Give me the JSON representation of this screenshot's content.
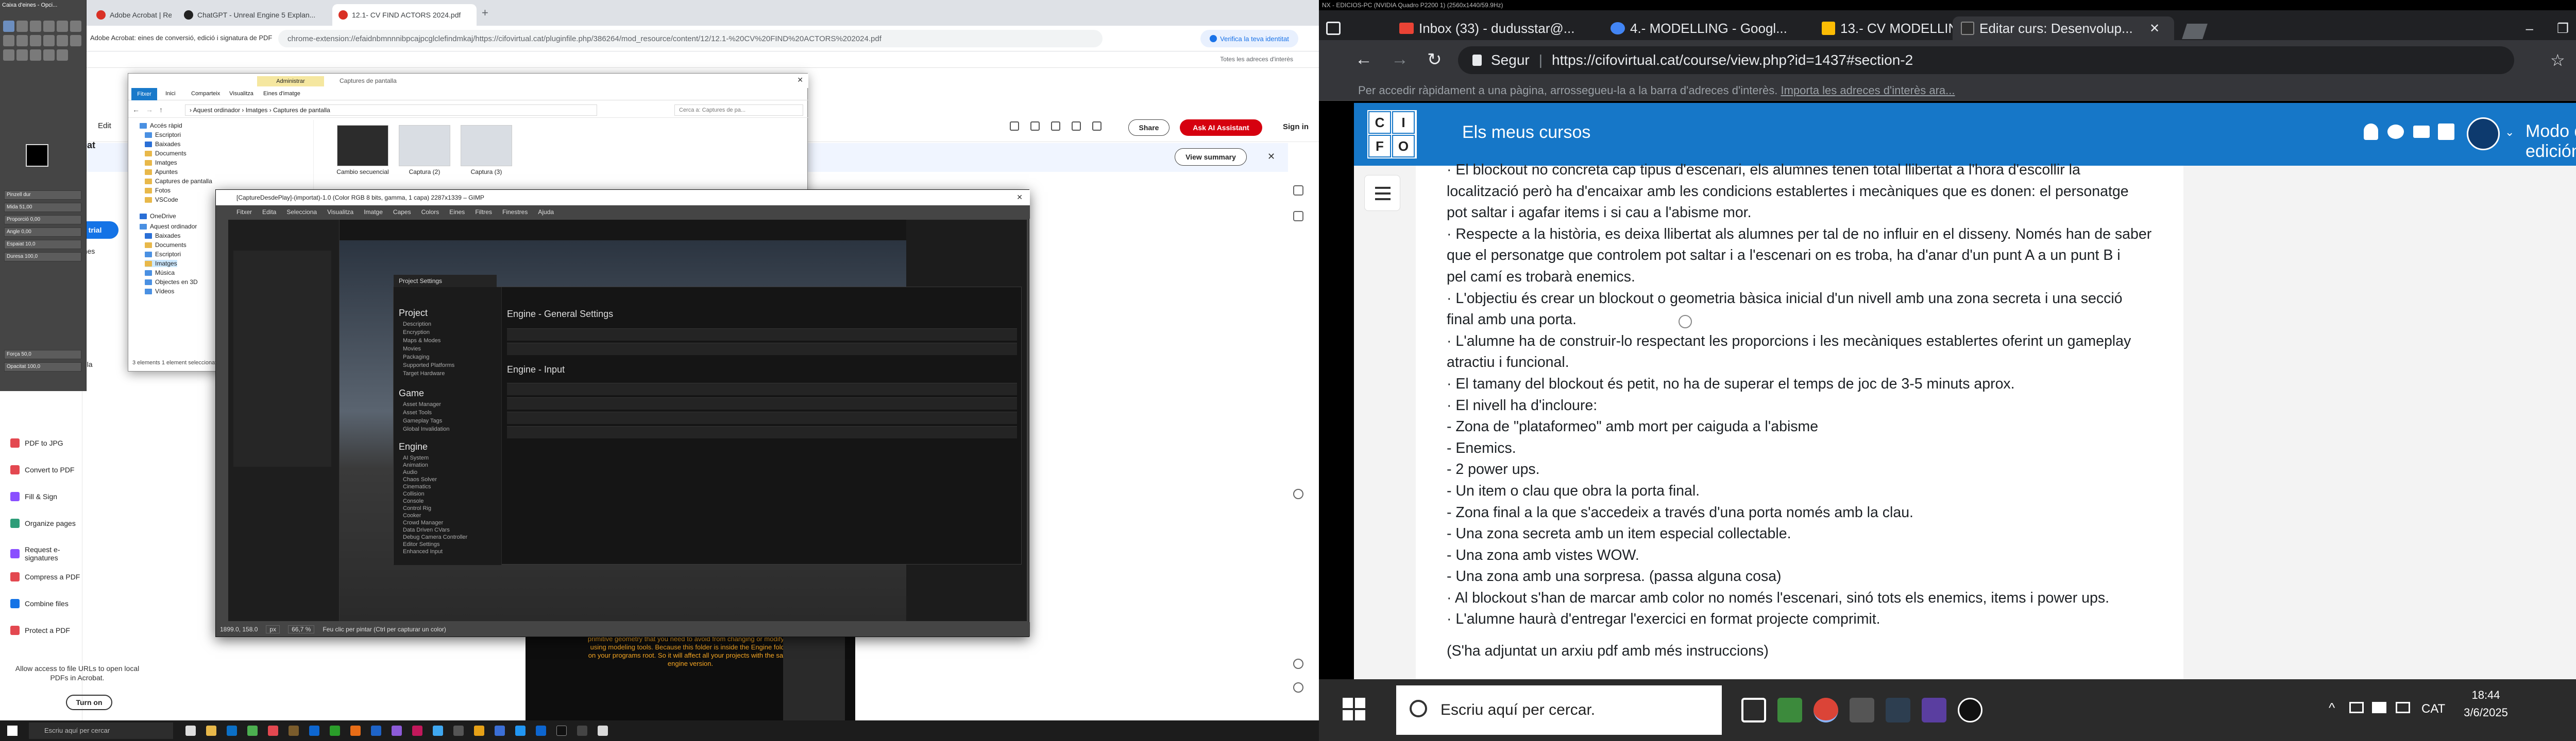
{
  "left_monitor": {
    "chrome": {
      "tabs": [
        {
          "label": "Adobe Acrobat | Resumeix fi...",
          "color": "#d93025"
        },
        {
          "label": "ChatGPT - Unreal Engine 5 Explan...",
          "color": "#222222"
        },
        {
          "label": "12.1- CV FIND ACTORS 2024.pdf",
          "color": "#d93025"
        }
      ],
      "new_tab": "+",
      "ad_label": "Adobe Acrobat: eines de conversió, edició i signatura de PDF",
      "url": "chrome-extension://efaidnbmnnnibpcajpcglclefindmkaj/https://cifovirtual.cat/pluginfile.php/386264/mod_resource/content/12/12.1-%20CV%20FIND%20ACTORS%202024.pdf",
      "verify_label": "Verifica la teva identitat",
      "bookmarks_label": "Totes les adreces d'interès"
    },
    "acrobat": {
      "edit_menu": "Edit",
      "share_label": "Share",
      "ask_label": "Ask AI Assistant",
      "signin_label": "Sign in",
      "view_summary": "View summary",
      "acrobat_partial": "crobat",
      "free_trial": "e trial",
      "tools": [
        "PDF to JPG",
        "Convert to PDF",
        "Fill & Sign",
        "Organize pages",
        "Request e-signatures",
        "Compress a PDF",
        "Combine files",
        "Protect a PDF"
      ],
      "side_frag": [
        "Ienes",
        "Icula"
      ],
      "bottom_note": "Allow access to file URLs to open local PDFs in Acrobat.",
      "turn_on": "Turn on",
      "pdf_text": "primitive geometry that you need to avoid from changing or modifying using modeling tools. Because this folder is inside the Engine folder on your programs root. So it will affect all your projects with the same engine version."
    },
    "gimp_toolbox": {
      "title": "Caixa d'eines - Opci...",
      "props": [
        "Pinzell dur",
        "Mida 51,00",
        "Proporció 0,00",
        "Angle 0,00",
        "Espaiat 10,0",
        "Duresa 100,0",
        "Força 50,0",
        "Opacitat 100,0"
      ]
    },
    "explorer": {
      "title": "Captures de pantalla",
      "manage_tab": "Administrar",
      "ribbon": [
        "Fitxer",
        "Inici",
        "Comparteix",
        "Visualitza",
        "Eines d'imatge"
      ],
      "path": "› Aquest ordinador › Imatges › Captures de pantalla",
      "search_placeholder": "Cerca a: Captures de pa...",
      "nav": [
        "Accés ràpid",
        "Escriptori",
        "Baixades",
        "Documents",
        "Imatges",
        "Apuntes",
        "Captures de pantalla",
        "Fotos",
        "VSCode",
        "OneDrive",
        "Aquest ordinador",
        "Baixades",
        "Documents",
        "Escriptori",
        "Imatges",
        "Música",
        "Objectes en 3D",
        "Vídeos"
      ],
      "files": [
        "Cambio secuencial",
        "Captura (2)",
        "Captura (3)"
      ],
      "status": "3 elements   1 element seleccionat"
    },
    "gimp_window": {
      "title": "[CaptureDesdePlay]-(importat)-1.0 (Color RGB 8 bits, gamma, 1 capa) 2287x1339 – GIMP",
      "menu": [
        "Fitxer",
        "Edita",
        "Selecciona",
        "Visualitza",
        "Imatge",
        "Capes",
        "Colors",
        "Eines",
        "Filtres",
        "Finestres",
        "Ajuda"
      ],
      "status_coords": "1899.0, 158.0",
      "status_unit": "px",
      "status_zoom": "66,7 %",
      "status_hint": "Feu clic per pintar (Ctrl per capturar un color)",
      "ue_project_settings": "Project Settings",
      "ue_side": [
        {
          "h": "Project",
          "items": [
            "Description",
            "Encryption",
            "Maps & Modes",
            "Movies",
            "Packaging",
            "Supported Platforms",
            "Target Hardware"
          ]
        },
        {
          "h": "Game",
          "items": [
            "Asset Manager",
            "Asset Tools",
            "Gameplay Tags",
            "Global Invalidation"
          ]
        },
        {
          "h": "Engine",
          "items": [
            "AI System",
            "Animation",
            "Audio",
            "Chaos Solver",
            "Cinematics",
            "Collision",
            "Console",
            "Control Rig",
            "Cooker",
            "Crowd Manager",
            "Data Driven CVars",
            "Debug Camera Controller",
            "Editor Settings",
            "Enhanced Input"
          ]
        }
      ],
      "ue_sections": [
        "Engine - General Settings",
        "Engine - Input"
      ]
    },
    "taskbar_search": "Escriu aquí per cercar"
  },
  "right_monitor": {
    "window_title": "NX - EDICIOS-PC (NVIDIA Quadro P2200 1) (2560x1440/59.9Hz)",
    "tabs": [
      {
        "label": "Inbox (33) - dudusstar@...",
        "color": "#ea4335"
      },
      {
        "label": "4.- MODELLING - Googl...",
        "color": "#4285f4"
      },
      {
        "label": "13.- CV MODELLING 202...",
        "color": "#fbbc04"
      },
      {
        "label": "Editar curs: Desenvolup...",
        "color": "#2e2e2e"
      }
    ],
    "address_prefix": "Segur",
    "address": "https://cifovirtual.cat/course/view.php?id=1437#section-2",
    "infobar_text": "Per accedir ràpidament a una pàgina, arrossegueu-la a la barra d'adreces d'interès.",
    "infobar_link": "Importa les adreces d'interès ara...",
    "site": {
      "logo_letters": [
        "C",
        "I",
        "F",
        "O"
      ],
      "title": "Els meus cursos",
      "edit_mode": "Modo de edición"
    },
    "content_lines": [
      "· El blockout no concreta cap tipus d'escenari, els alumnes tenen total llibertat a l'hora d'escollir la",
      "localització però ha d'encaixar amb les condicions establertes i mecàniques que es donen: el personatge",
      "pot saltar i agafar items i si cau a l'abisme mor.",
      "· Respecte a la història, es deixa llibertat als alumnes per tal de no influir en el disseny. Només han de saber",
      "que el personatge que controlem pot saltar i a l'escenari on es troba, ha d'anar d'un punt A a un punt B i",
      "pel camí es trobarà enemics.",
      "· L'objectiu és crear un blockout o geometria bàsica inicial d'un nivell amb una zona secreta i una secció",
      "final amb una porta.",
      "· L'alumne ha de construir-lo respectant les proporcions i les mecàniques establertes oferint un gameplay",
      "atractiu i funcional.",
      "· El tamany del blockout és petit, no ha de superar el temps de joc de 3-5 minuts aprox.",
      "· El nivell ha d'incloure:",
      "- Zona de \"plataformeo\" amb mort per caiguda a l'abisme",
      "- Enemics.",
      "- 2 power ups.",
      "- Un item o clau que obra la porta final.",
      "- Zona final a la que s'accedeix a través d'una porta només amb la clau.",
      "- Una zona secreta amb un item especial collectable.",
      "- Una zona amb vistes WOW.",
      "- Una zona amb una sorpresa. (passa alguna cosa)",
      "· Al blockout s'han de marcar amb color no només l'escenari, sinó tots els enemics, items i power ups.",
      "· L'alumne haurà d'entregar l'exercici en format projecte comprimit."
    ],
    "content_footer": "(S'ha adjuntat un arxiu pdf amb més instruccions)",
    "taskbar": {
      "search_placeholder": "Escriu aquí per cercar.",
      "lang": "CAT",
      "time": "18:44",
      "date": "3/6/2025"
    }
  }
}
